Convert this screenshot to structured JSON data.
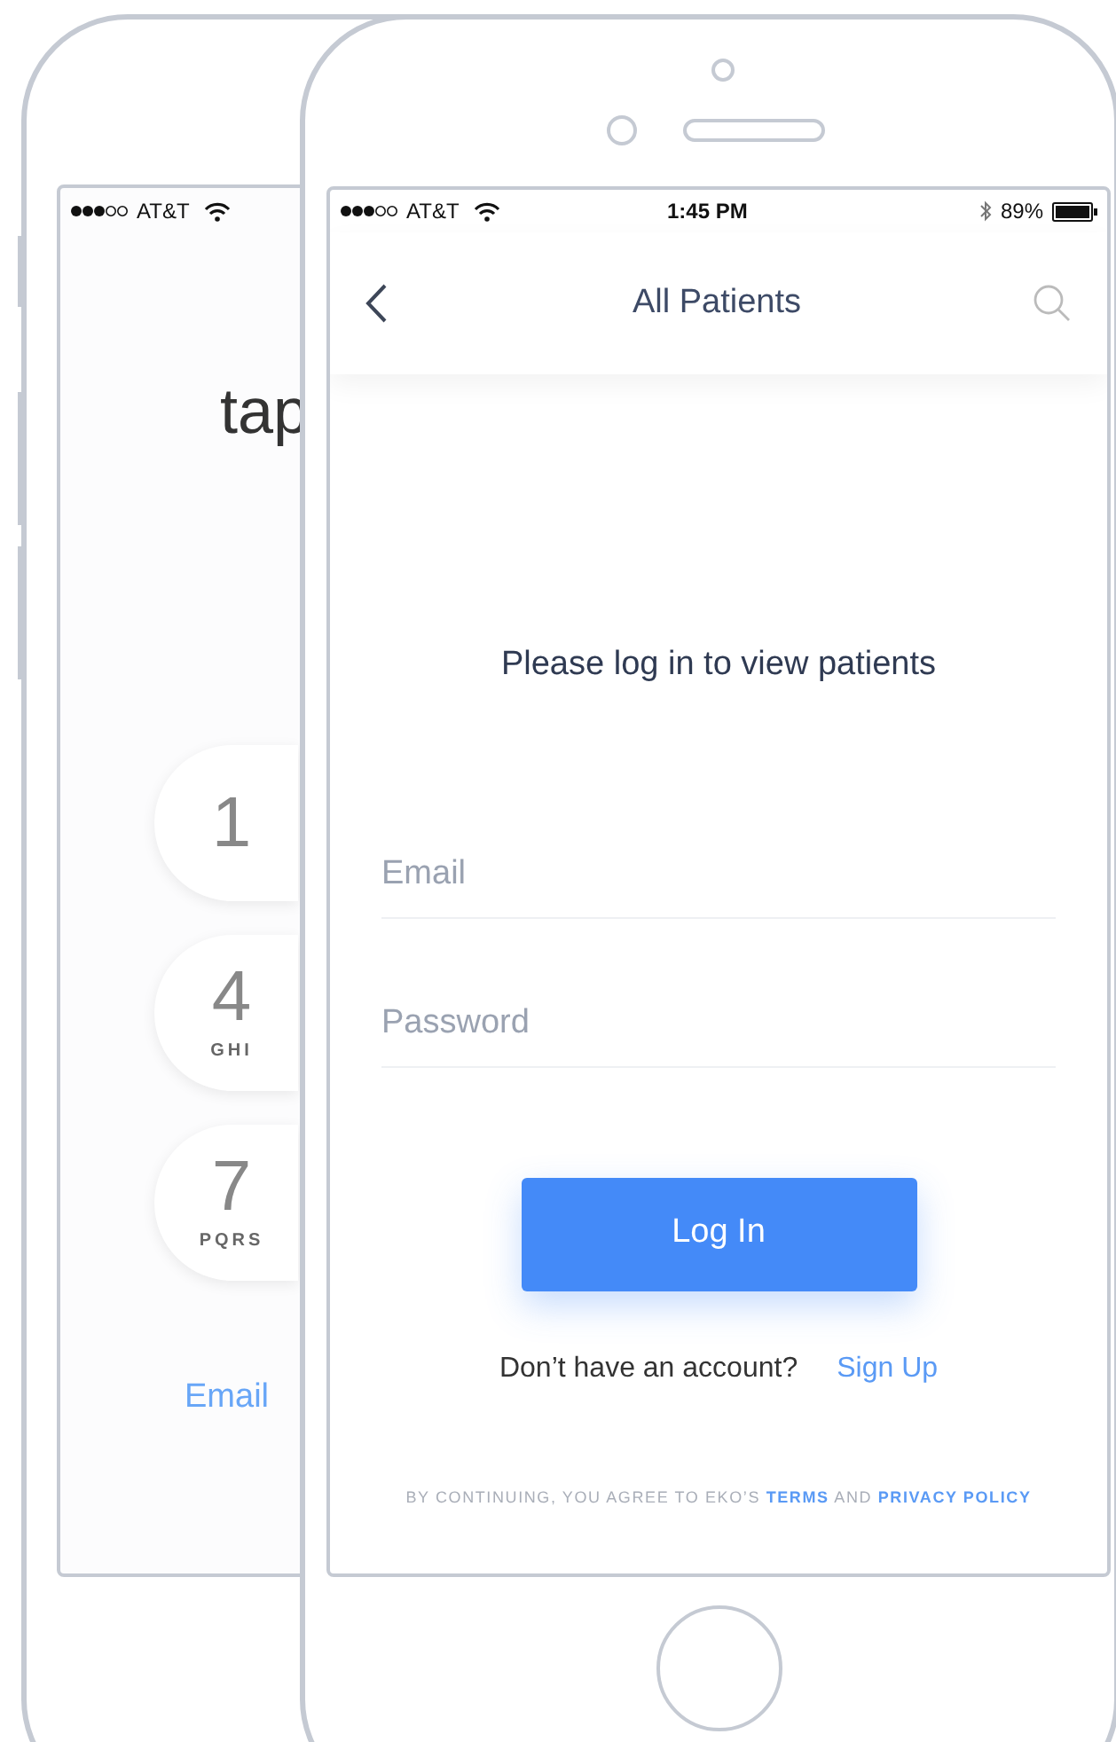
{
  "back_phone": {
    "status_bar": {
      "carrier": "AT&T"
    },
    "heading": "tap",
    "keys": [
      {
        "digit": "1"
      },
      {
        "digit": "4",
        "letters": "GHI"
      },
      {
        "digit": "7",
        "letters": "PQRS"
      }
    ],
    "link": "Email"
  },
  "front_phone": {
    "status_bar": {
      "carrier": "AT&T",
      "time": "1:45 PM",
      "battery": "89%"
    },
    "nav": {
      "title": "All Patients"
    },
    "message": "Please log in to view patients",
    "fields": [
      {
        "placeholder": "Email"
      },
      {
        "placeholder": "Password"
      }
    ],
    "button": "Log In",
    "signup": {
      "prompt": "Don’t have an account?",
      "link": "Sign Up"
    },
    "legal": {
      "text": "BY CONTINUING, YOU AGREE TO EKO’S",
      "terms": "TERMS",
      "and": "AND",
      "privacy": "PRIVACY POLICY"
    }
  }
}
